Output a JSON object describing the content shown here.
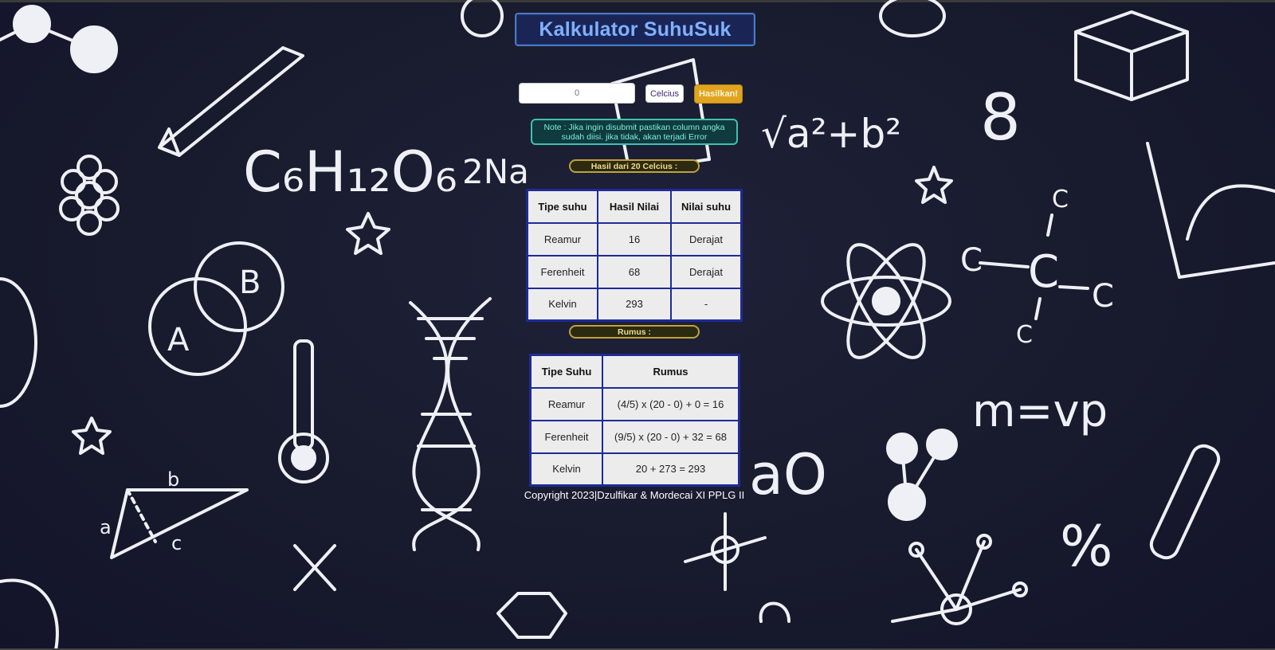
{
  "app": {
    "title": "Kalkulator SuhuSuk"
  },
  "form": {
    "input_placeholder": "0",
    "unit_selected": "Celcius",
    "submit_label": "Hasilkan!"
  },
  "note": "Note : Jika ingin disubmit pastikan column angka sudah diisi. jika tidak, akan terjadi Error",
  "result": {
    "heading": "Hasil dari 20 Celcius :",
    "headers": [
      "Tipe suhu",
      "Hasil Nilai",
      "Nilai suhu"
    ],
    "rows": [
      [
        "Reamur",
        "16",
        "Derajat"
      ],
      [
        "Ferenheit",
        "68",
        "Derajat"
      ],
      [
        "Kelvin",
        "293",
        "-"
      ]
    ]
  },
  "rumus": {
    "heading": "Rumus :",
    "headers": [
      "Tipe Suhu",
      "Rumus"
    ],
    "rows": [
      [
        "Reamur",
        "(4/5) x (20 - 0) + 0 = 16"
      ],
      [
        "Ferenheit",
        "(9/5) x (20 - 0) + 32 = 68"
      ],
      [
        "Kelvin",
        "20 + 273 = 293"
      ]
    ]
  },
  "footer": "Copyright 2023|Dzulfikar & Mordecai XI PPLG II",
  "colors": {
    "background": "#181a2d",
    "title_text": "#7fb0ff",
    "submit_button": "#e0a421",
    "note_border": "#3fc1b0",
    "table_border": "#1e2a96"
  }
}
